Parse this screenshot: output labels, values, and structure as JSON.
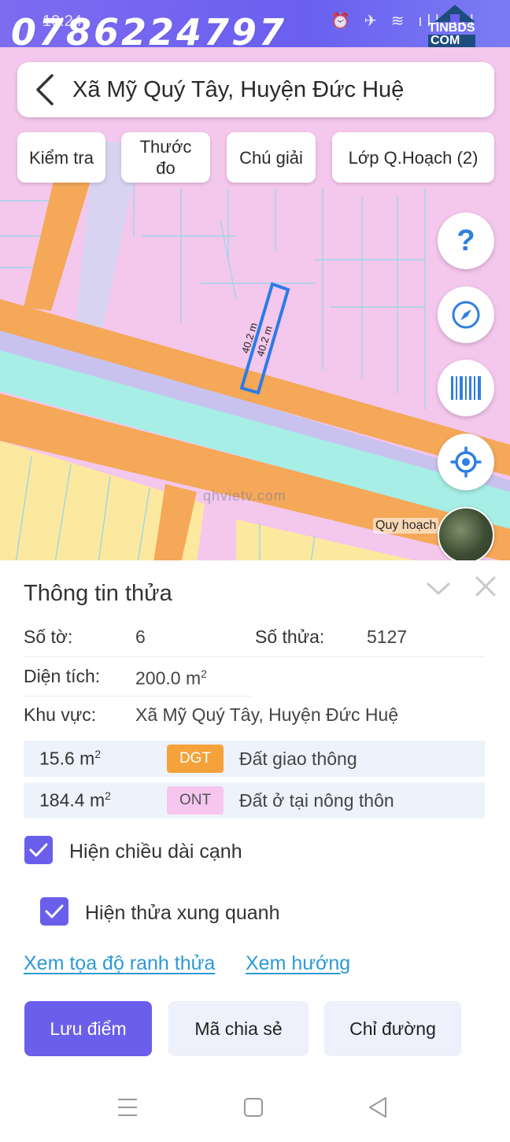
{
  "status_bar": {
    "time": "10:24",
    "icons": "⏰ ✈ ≋ ıll ıll",
    "phone_watermark": "0786224797",
    "brand_name": "TINBDS",
    "brand_suffix": "COM"
  },
  "search": {
    "back_icon": "chevron-left-icon",
    "location": "Xã Mỹ Quý Tây, Huyện Đức Huệ"
  },
  "chips": {
    "check": "Kiểm tra",
    "ruler_line1": "Thước",
    "ruler_line2": "đo",
    "legend": "Chú giải",
    "planning_layer": "Lớp Q.Hoạch (2)"
  },
  "map": {
    "fab_help": "?",
    "edge_length_1": "40.2 m",
    "edge_length_2": "40.2 m",
    "watermark": "qhvietv.com",
    "layer_label": "Quy hoạch",
    "colors": {
      "residential": "#f4c7ec",
      "road": "#f4a858",
      "canal": "#a6eee6",
      "agri": "#fde8a0",
      "selection": "#2a7be8"
    }
  },
  "panel": {
    "title": "Thông tin thửa",
    "sheet_label": "Số tờ:",
    "sheet_value": "6",
    "parcel_label": "Số thửa:",
    "parcel_value": "5127",
    "area_label": "Diện tích:",
    "area_value": "200.0 m",
    "area_unit_sup": "2",
    "region_label": "Khu vực:",
    "region_value": "Xã Mỹ Quý Tây, Huyện Đức Huệ",
    "land_uses": [
      {
        "area": "15.6 m",
        "sup": "2",
        "code": "DGT",
        "desc": "Đất giao thông",
        "color": "#f5a23a"
      },
      {
        "area": "184.4 m",
        "sup": "2",
        "code": "ONT",
        "desc": "Đất ở tại nông thôn",
        "color": "#f6c6ef"
      }
    ],
    "show_edge_length": "Hiện chiều dài cạnh",
    "show_neighbors": "Hiện thửa xung quanh",
    "link_coordinates": "Xem tọa độ ranh thửa",
    "link_direction": "Xem hướng",
    "btn_save": "Lưu điểm",
    "btn_share": "Mã chia sẻ",
    "btn_directions": "Chỉ đường"
  }
}
